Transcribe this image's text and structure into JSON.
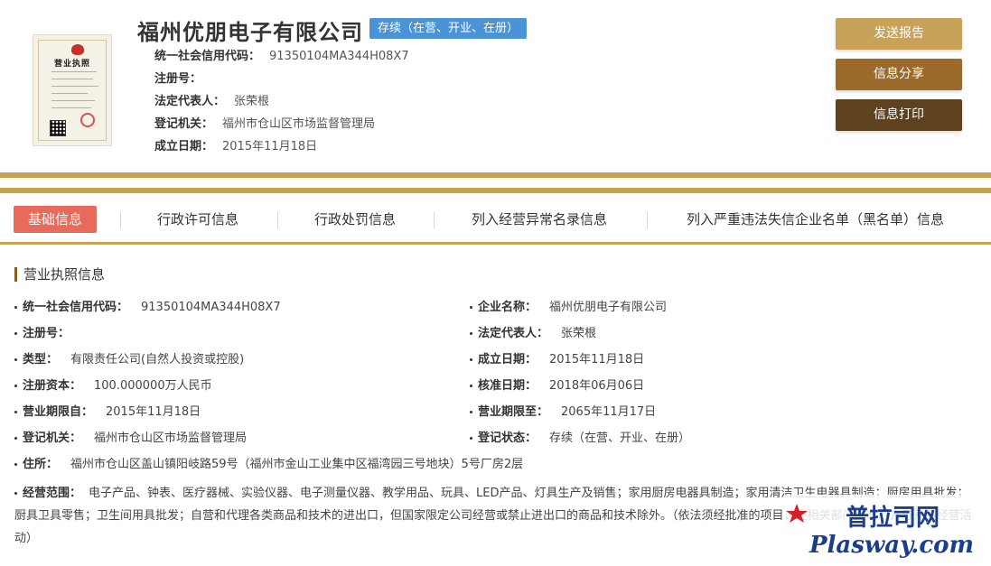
{
  "header": {
    "license_image": {
      "title": "营业执照",
      "icon": "business-license-icon"
    },
    "company_name": "福州优朋电子有限公司",
    "status_badge": "存续（在营、开业、在册）",
    "fields": [
      {
        "label": "统一社会信用代码：",
        "value": "91350104MA344H08X7"
      },
      {
        "label": "注册号：",
        "value": ""
      },
      {
        "label": "法定代表人：",
        "value": "张荣根"
      },
      {
        "label": "登记机关：",
        "value": "福州市仓山区市场监督管理局"
      },
      {
        "label": "成立日期：",
        "value": "2015年11月18日"
      }
    ],
    "actions": {
      "send_report": "发送报告",
      "share_info": "信息分享",
      "print_info": "信息打印"
    }
  },
  "tabs": [
    {
      "label": "基础信息",
      "active": true
    },
    {
      "label": "行政许可信息",
      "active": false
    },
    {
      "label": "行政处罚信息",
      "active": false
    },
    {
      "label": "列入经营异常名录信息",
      "active": false
    },
    {
      "label": "列入严重违法失信企业名单（黑名单）信息",
      "active": false
    }
  ],
  "section": {
    "title": "营业执照信息",
    "left": [
      {
        "label": "统一社会信用代码：",
        "value": "91350104MA344H08X7"
      },
      {
        "label": "注册号：",
        "value": ""
      },
      {
        "label": "类型：",
        "value": "有限责任公司(自然人投资或控股)"
      },
      {
        "label": "注册资本：",
        "value": "100.000000万人民币"
      },
      {
        "label": "营业期限自：",
        "value": "2015年11月18日"
      },
      {
        "label": "登记机关：",
        "value": "福州市仓山区市场监督管理局"
      }
    ],
    "right": [
      {
        "label": "企业名称：",
        "value": "福州优朋电子有限公司"
      },
      {
        "label": "法定代表人：",
        "value": "张荣根"
      },
      {
        "label": "成立日期：",
        "value": "2015年11月18日"
      },
      {
        "label": "核准日期：",
        "value": "2018年06月06日"
      },
      {
        "label": "营业期限至：",
        "value": "2065年11月17日"
      },
      {
        "label": "登记状态：",
        "value": "存续（在营、开业、在册）"
      }
    ],
    "address": {
      "label": "住所：",
      "value": "福州市仓山区盖山镇阳岐路59号（福州市金山工业集中区福湾园三号地块）5号厂房2层"
    },
    "scope": {
      "label": "经营范围：",
      "value": "电子产品、钟表、医疗器械、实验仪器、电子测量仪器、教学用品、玩具、LED产品、灯具生产及销售；家用厨房电器具制造；家用清洁卫生电器具制造；厨房用具批发；厨具卫具零售；卫生间用具批发；自营和代理各类商品和技术的进出口，但国家限定公司经营或禁止进出口的商品和技术除外。（依法须经批准的项目，经相关部门批准后方可开展经营活动）"
    }
  },
  "watermark": {
    "brand_cn": "普拉司网",
    "brand_en": "Plasway.com"
  },
  "colors": {
    "gold": "#c8a24e",
    "btn_send": "#c9a25a",
    "btn_share": "#9c6b2b",
    "btn_print": "#5e4220",
    "tab_active": "#e86a5a",
    "badge": "#4a93d6"
  }
}
